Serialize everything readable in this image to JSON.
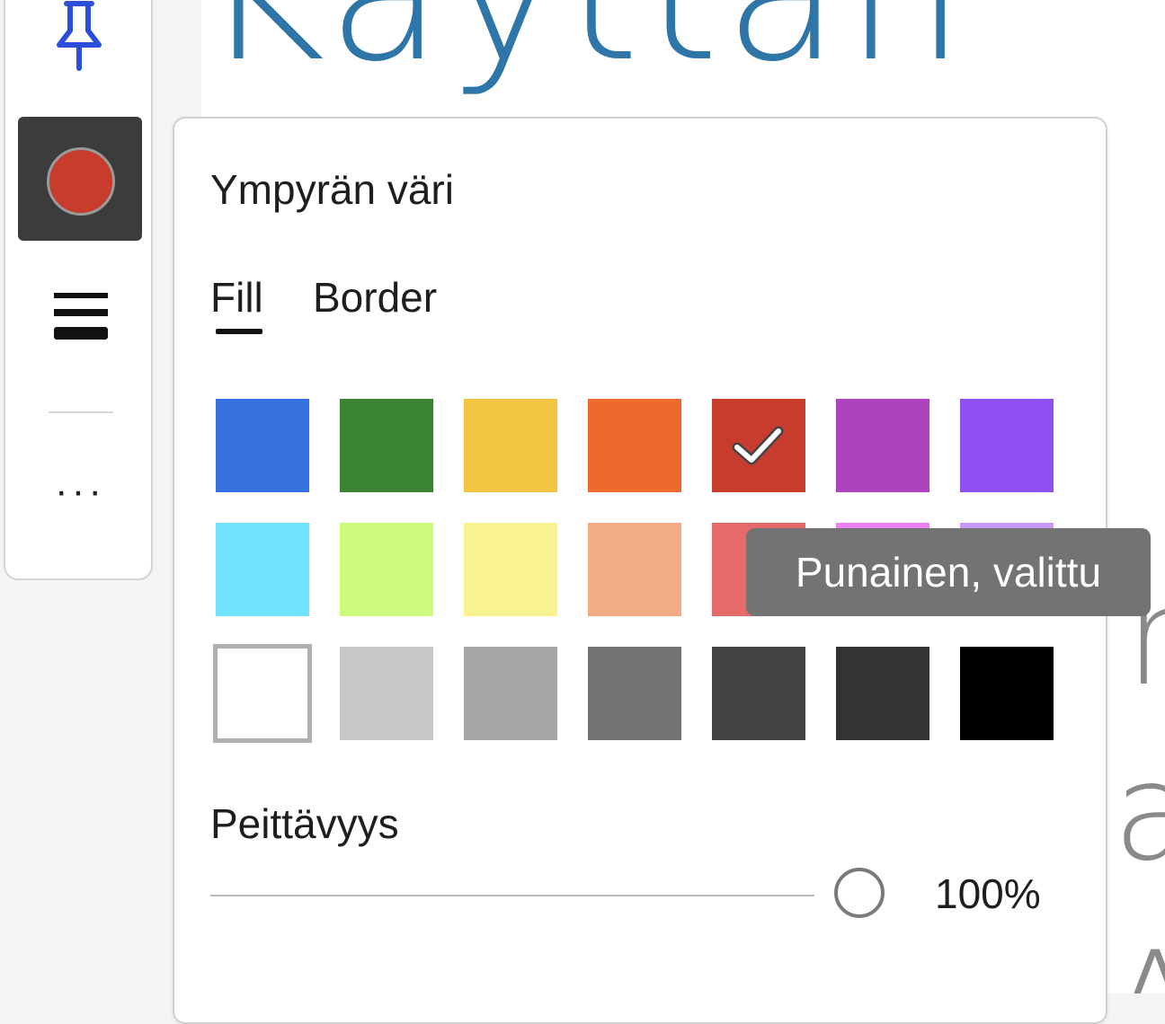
{
  "popup": {
    "title": "Ympyrän väri",
    "tabs": [
      {
        "label": "Fill",
        "active": true
      },
      {
        "label": "Border",
        "active": false
      }
    ],
    "swatches": [
      [
        "#3471df",
        "#3a8331",
        "#f4c443",
        "#eb6a2c",
        "#c83c2e",
        "#ae44bd",
        "#8d4ff0"
      ],
      [
        "#6ee3fb",
        "#cdf97c",
        "#f8f390",
        "#f2ab84",
        "#e56a6a",
        "#ea82f2",
        "#c99af3"
      ],
      [
        "#ffffff",
        "#c8c8c8",
        "#a6a6a6",
        "#737373",
        "#444444",
        "#333333",
        "#000000"
      ]
    ],
    "selected_color": "#c83c2e",
    "opacity_label": "Peittävyys",
    "opacity_value": "100%",
    "opacity_level": 1.0
  },
  "tooltip": {
    "text": "Punainen, valittu"
  },
  "toolbar": {
    "active_shape_color": "#c83c2e",
    "more_label": "···"
  },
  "document": {
    "heading_fragment": "Käyttän",
    "fragments": [
      "n",
      "nj",
      "ah",
      "A"
    ]
  }
}
